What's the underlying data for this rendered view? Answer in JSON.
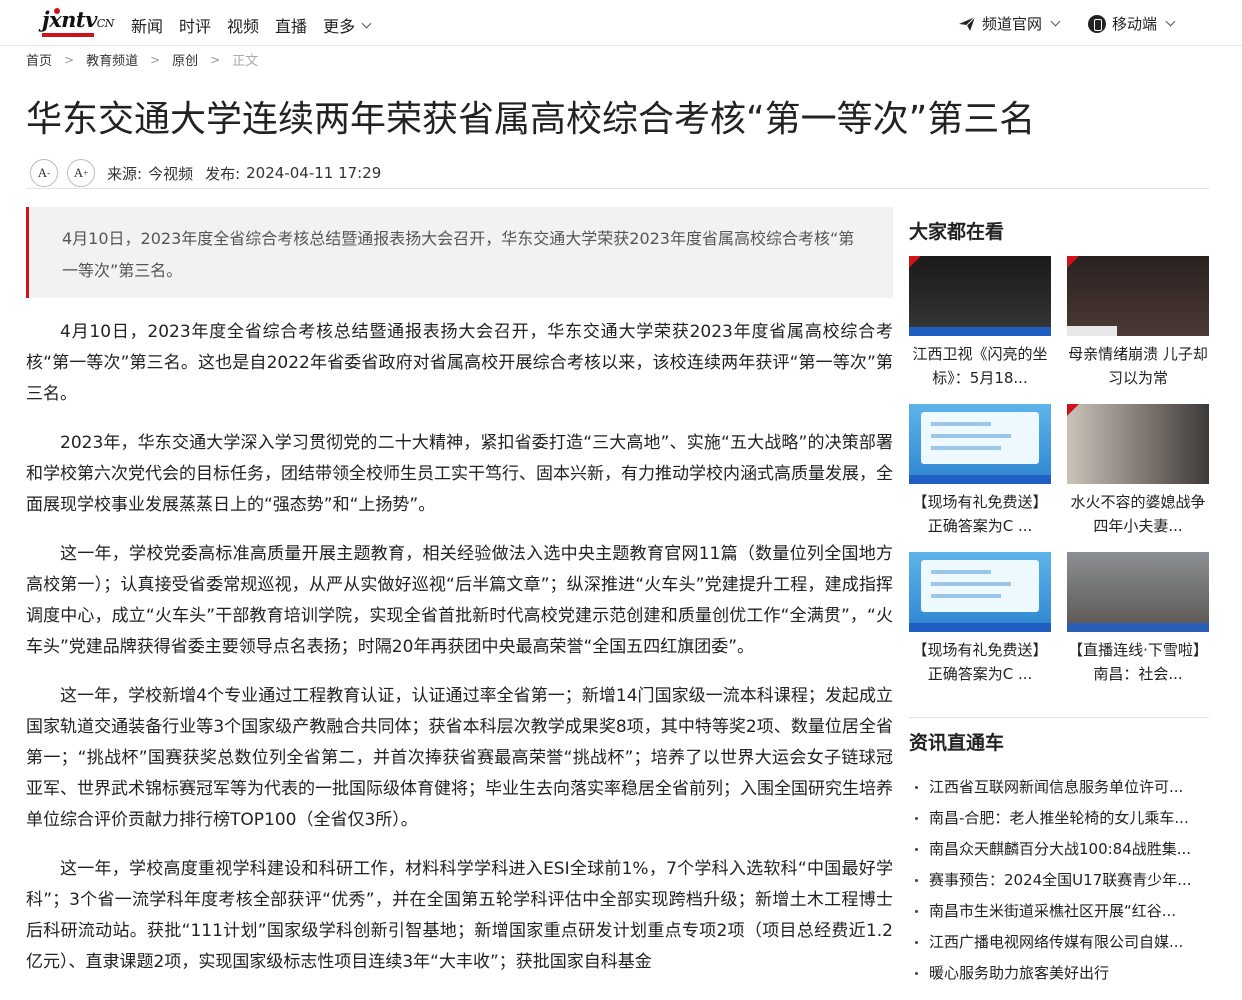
{
  "site": {
    "logo_text": "jxntv",
    "logo_suffix": "CN",
    "nav": [
      "新闻",
      "时评",
      "视频",
      "直播",
      "更多"
    ],
    "channel_label": "频道官网",
    "mobile_label": "移动端"
  },
  "breadcrumb": [
    "首页",
    "教育频道",
    "原创",
    "正文"
  ],
  "article": {
    "title": "华东交通大学连续两年荣获省属高校综合考核“第一等次”第三名",
    "source_label": "来源:",
    "source": "今视频",
    "publish_label": "发布:",
    "publish_time": "2024-04-11 17:29",
    "font_decrease": "A",
    "font_increase": "A",
    "summary": "4月10日，2023年度全省综合考核总结暨通报表扬大会召开，华东交通大学荣获2023年度省属高校综合考核“第一等次”第三名。",
    "paragraphs": [
      "4月10日，2023年度全省综合考核总结暨通报表扬大会召开，华东交通大学荣获2023年度省属高校综合考核“第一等次”第三名。这也是自2022年省委省政府对省属高校开展综合考核以来，该校连续两年获评“第一等次”第三名。",
      "2023年，华东交通大学深入学习贯彻党的二十大精神，紧扣省委打造“三大高地”、实施“五大战略”的决策部署和学校第六次党代会的目标任务，团结带领全校师生员工实干笃行、固本兴新，有力推动学校内涵式高质量发展，全面展现学校事业发展蒸蒸日上的“强态势”和“上扬势”。",
      "这一年，学校党委高标准高质量开展主题教育，相关经验做法入选中央主题教育官网11篇（数量位列全国地方高校第一）；认真接受省委常规巡视，从严从实做好巡视“后半篇文章”；纵深推进“火车头”党建提升工程，建成指挥调度中心，成立“火车头”干部教育培训学院，实现全省首批新时代高校党建示范创建和质量创优工作“全满贯”，“火车头”党建品牌获得省委主要领导点名表扬；时隔20年再获团中央最高荣誉“全国五四红旗团委”。",
      "这一年，学校新增4个专业通过工程教育认证，认证通过率全省第一；新增14门国家级一流本科课程；发起成立国家轨道交通装备行业等3个国家级产教融合共同体；获省本科层次教学成果奖8项，其中特等奖2项、数量位居全省第一；“挑战杯”国赛获奖总数位列全省第二，并首次捧获省赛最高荣誉“挑战杯”；培养了以世界大运会女子链球冠亚军、世界武术锦标赛冠军等为代表的一批国际级体育健将；毕业生去向落实率稳居全省前列；入围全国研究生培养单位综合评价贡献力排行榜TOP100（全省仅3所）。",
      "这一年，学校高度重视学科建设和科研工作，材料科学学科进入ESI全球前1%，7个学科入选软科“中国最好学科”；3个省一流学科年度考核全部获评“优秀”，并在全国第五轮学科评估中全部实现跨档升级；新增土木工程博士后科研流动站。获批“111计划”国家级学科创新引智基地；新增国家重点研发计划重点专项2项（项目总经费近1.2亿元）、直隶课题2项，实现国家级标志性项目连续3年“大丰收”；获批国家自科基金"
    ]
  },
  "sidebar": {
    "popular_title": "大家都在看",
    "popular": [
      {
        "caption": "江西卫视《闪亮的坐标》：5月18..."
      },
      {
        "caption": "母亲情绪崩溃 儿子却习以为常"
      },
      {
        "caption": "【现场有礼免费送】正确答案为C ..."
      },
      {
        "caption": "水火不容的婆媳战争 四年小夫妻..."
      },
      {
        "caption": "【现场有礼免费送】正确答案为C ..."
      },
      {
        "caption": "【直播连线·下雪啦】南昌：社会..."
      }
    ],
    "news_title": "资讯直通车",
    "news": [
      "江西省互联网新闻信息服务单位许可...",
      "南昌-合肥：老人推坐轮椅的女儿乘车...",
      "南昌众天麒麟百分大战100:84战胜集...",
      "赛事预告：2024全国U17联赛青少年...",
      "南昌市生米街道采樵社区开展“红谷...",
      "江西广播电视网络传媒有限公司自媒...",
      "暖心服务助力旅客美好出行"
    ]
  }
}
